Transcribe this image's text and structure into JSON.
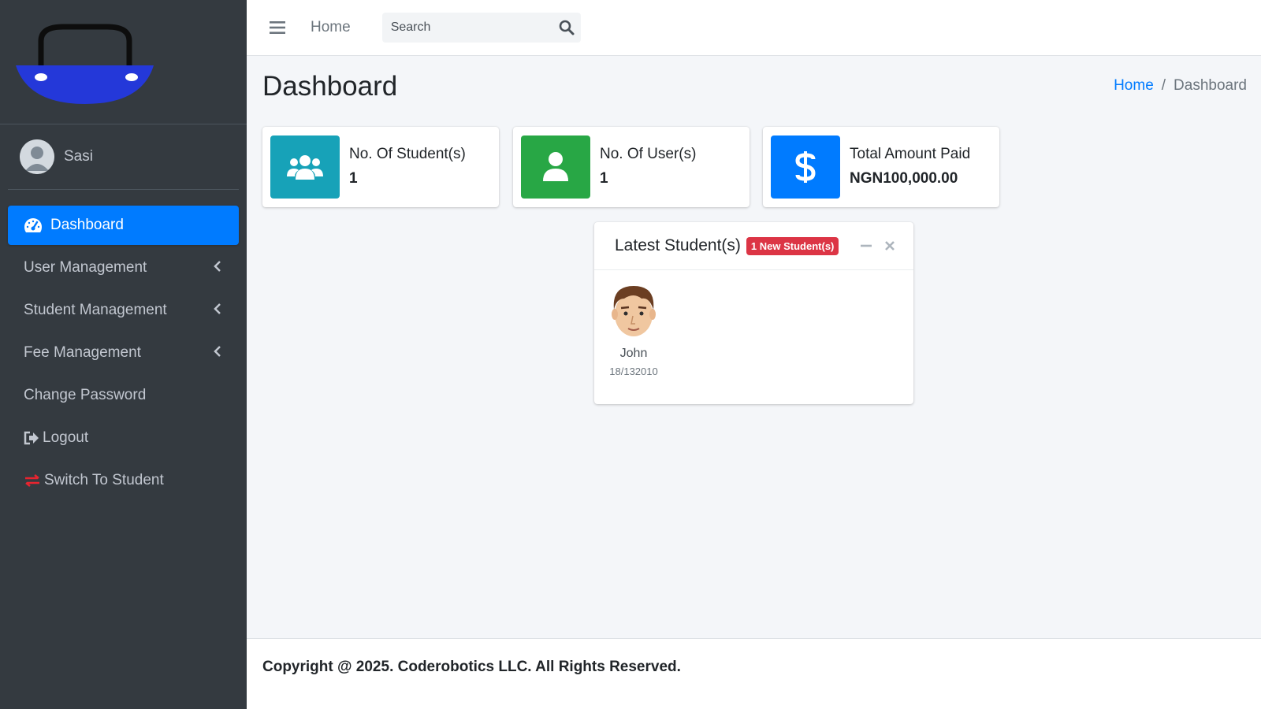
{
  "sidebar": {
    "user_name": "Sasi",
    "items": [
      {
        "label": "Dashboard",
        "icon": "tachometer-icon",
        "active": true
      },
      {
        "label": "User Management",
        "icon": "chevron-left-icon"
      },
      {
        "label": "Student Management",
        "icon": "chevron-left-icon"
      },
      {
        "label": "Fee Management",
        "icon": "chevron-left-icon"
      },
      {
        "label": "Change Password"
      },
      {
        "label": "Logout",
        "icon": "sign-out-icon"
      },
      {
        "label": "Switch To Student",
        "icon": "exchange-icon"
      }
    ]
  },
  "topbar": {
    "home_label": "Home",
    "search_placeholder": "Search"
  },
  "header": {
    "title": "Dashboard",
    "breadcrumb": [
      "Home",
      "Dashboard"
    ]
  },
  "info_boxes": [
    {
      "label": "No. Of Student(s)",
      "value": "1",
      "color": "#17a2b8",
      "icon": "users-icon"
    },
    {
      "label": "No. Of User(s)",
      "value": "1",
      "color": "#28a745",
      "icon": "user-icon"
    },
    {
      "label": "Total Amount Paid",
      "value": "NGN100,000.00",
      "color": "#007bff",
      "icon": "dollar-icon"
    }
  ],
  "latest_students": {
    "title": "Latest Student(s)",
    "badge": "1 New Student(s)",
    "students": [
      {
        "name": "John",
        "id": "18/132010"
      }
    ]
  },
  "footer": {
    "text": "Copyright @ 2025. Coderobotics LLC. All Rights Reserved."
  },
  "colors": {
    "sidebar_bg": "#343a40",
    "accent": "#007bff",
    "badge": "#dc3545",
    "info": "#17a2b8",
    "success": "#28a745"
  }
}
